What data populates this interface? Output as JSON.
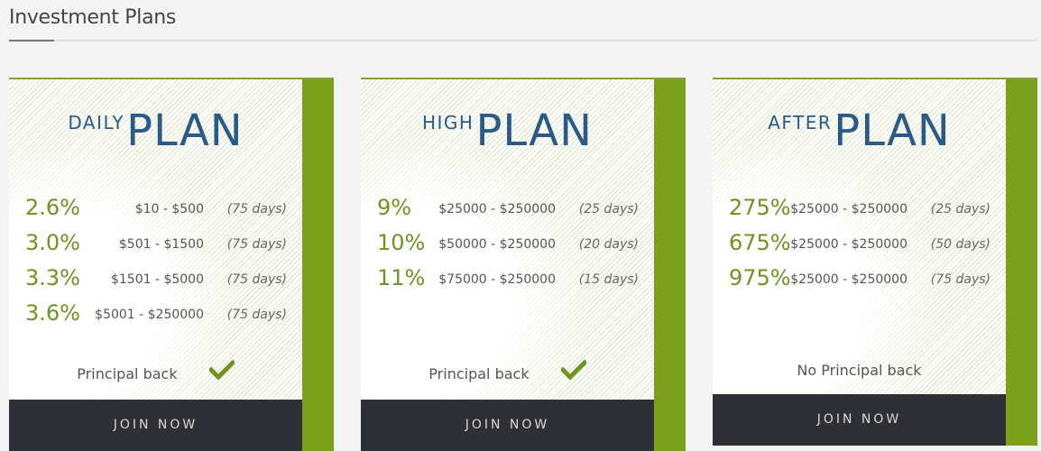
{
  "page": {
    "title": "Investment Plans"
  },
  "plans": [
    {
      "name_small": "DAILY",
      "name_big": "PLAN",
      "rows": [
        {
          "rate": "2.6%",
          "range": "$10 - $500",
          "duration": "(75 days)"
        },
        {
          "rate": "3.0%",
          "range": "$501 - $1500",
          "duration": "(75 days)"
        },
        {
          "rate": "3.3%",
          "range": "$1501 - $5000",
          "duration": "(75 days)"
        },
        {
          "rate": "3.6%",
          "range": "$5001 - $250000",
          "duration": "(75 days)"
        }
      ],
      "principal": "Principal back",
      "principal_icon": "check-icon",
      "button": "JOIN NOW"
    },
    {
      "name_small": "HIGH",
      "name_big": "PLAN",
      "rows": [
        {
          "rate": "9%",
          "range": "$25000 - $250000",
          "duration": "(25 days)"
        },
        {
          "rate": "10%",
          "range": "$50000 - $250000",
          "duration": "(20 days)"
        },
        {
          "rate": "11%",
          "range": "$75000 - $250000",
          "duration": "(15 days)"
        }
      ],
      "principal": "Principal back",
      "principal_icon": "check-icon",
      "button": "JOIN NOW"
    },
    {
      "name_small": "AFTER",
      "name_big": "PLAN",
      "rows": [
        {
          "rate": "275%",
          "range": "$25000 - $250000",
          "duration": "(25 days)"
        },
        {
          "rate": "675%",
          "range": "$25000 - $250000",
          "duration": "(50 days)"
        },
        {
          "rate": "975%",
          "range": "$25000 - $250000",
          "duration": "(75 days)"
        }
      ],
      "principal": "No Principal back",
      "button": "JOIN NOW"
    }
  ],
  "colors": {
    "accent_green": "#7aa01c",
    "rate_green": "#6f9422",
    "plan_blue": "#2a5a87",
    "button_dark": "#2f3035"
  }
}
